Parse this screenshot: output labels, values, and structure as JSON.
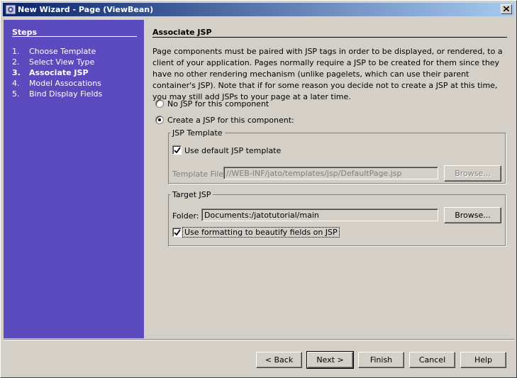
{
  "window": {
    "title": "New Wizard - Page (ViewBean)",
    "icon": "netbeans-app-icon"
  },
  "sidebar": {
    "heading": "Steps",
    "steps": [
      {
        "num": "1.",
        "label": "Choose Template"
      },
      {
        "num": "2.",
        "label": "Select View Type"
      },
      {
        "num": "3.",
        "label": "Associate JSP",
        "current": true
      },
      {
        "num": "4.",
        "label": "Model Assocations"
      },
      {
        "num": "5.",
        "label": "Bind Display Fields"
      }
    ],
    "color": "#5b4bbe"
  },
  "main": {
    "title": "Associate JSP",
    "description": "Page components must be paired with JSP tags in order to be displayed, or rendered, to a client of your application.  Pages normally require a JSP to be created for them since they have no other rendering mechanism (unlike pagelets, which can use their parent container's JSP).  Note that if for some reason you decide not to create a JSP at this time, you may still add JSPs to your page at a later time.",
    "radio_no_jsp": {
      "label": "No JSP for this component",
      "selected": false
    },
    "radio_create_jsp": {
      "label": "Create a JSP for this component:",
      "selected": true
    },
    "jsp_template": {
      "legend": "JSP Template",
      "use_default_label": "Use default JSP template",
      "use_default_checked": true,
      "file_label": "Template File:",
      "file_value": "//WEB-INF/jato/templates/jsp/DefaultPage.jsp",
      "browse_label": "Browse..."
    },
    "target_jsp": {
      "legend": "Target JSP",
      "folder_label": "Folder:",
      "folder_value": "Documents:/jatotutorial/main",
      "browse_label": "Browse...",
      "formatting_label": "Use formatting to beautify fields on JSP",
      "formatting_checked": true
    }
  },
  "buttons": {
    "back": "< Back",
    "next": "Next >",
    "finish": "Finish",
    "cancel": "Cancel",
    "help": "Help"
  }
}
